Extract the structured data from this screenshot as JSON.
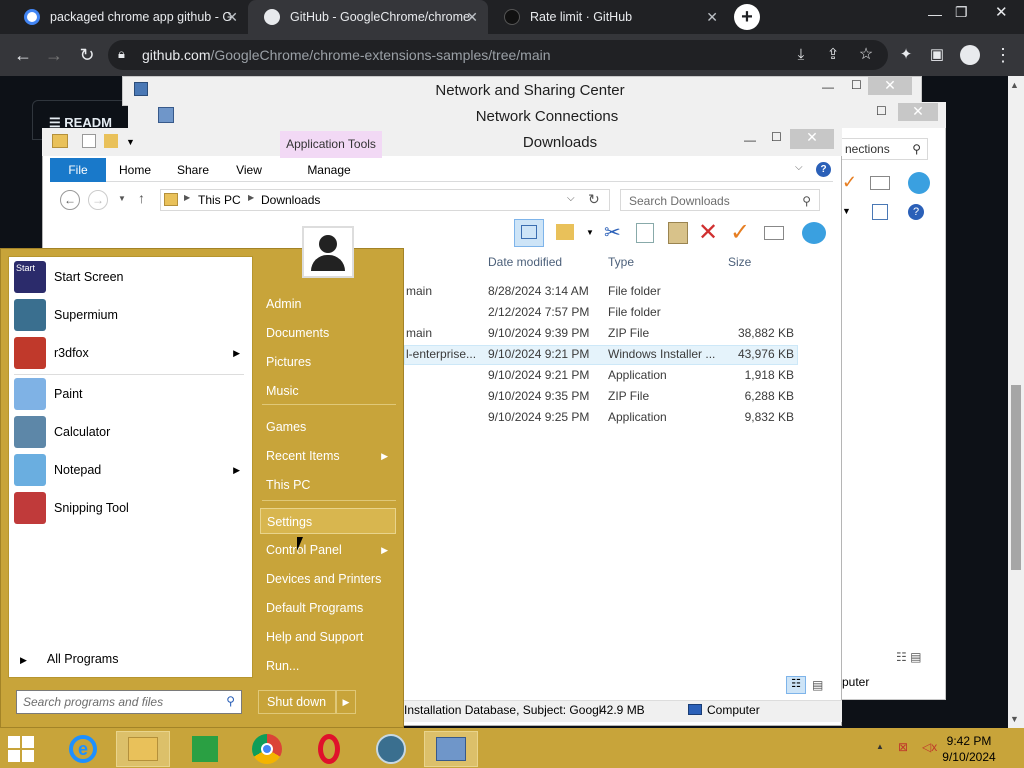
{
  "chrome": {
    "tabs": [
      {
        "title": "packaged chrome app github - G"
      },
      {
        "title": "GitHub - GoogleChrome/chrome-"
      },
      {
        "title": "Rate limit · GitHub"
      }
    ],
    "new_tab_icon": "+",
    "url_host": "github.com",
    "url_path": "/GoogleChrome/chrome-extensions-samples/tree/main"
  },
  "github": {
    "readme_label": "READM"
  },
  "windows": {
    "network_sharing_title": "Network and Sharing Center",
    "network_connections_title": "Network Connections",
    "nc_search_partial": "nections",
    "nc_status_partial": "puter"
  },
  "downloads": {
    "title": "Downloads",
    "app_tools": "Application Tools",
    "ribbon_tabs": [
      "File",
      "Home",
      "Share",
      "View",
      "Manage"
    ],
    "breadcrumb": [
      "This PC",
      "Downloads"
    ],
    "search_placeholder": "Search Downloads",
    "columns": [
      "Date modified",
      "Type",
      "Size"
    ],
    "rows": [
      {
        "name_partial": "main",
        "date": "8/28/2024 3:14 AM",
        "type": "File folder",
        "size": ""
      },
      {
        "name_partial": "",
        "date": "2/12/2024 7:57 PM",
        "type": "File folder",
        "size": ""
      },
      {
        "name_partial": "main",
        "date": "9/10/2024 9:39 PM",
        "type": "ZIP File",
        "size": "38,882 KB"
      },
      {
        "name_partial": "l-enterprise...",
        "date": "9/10/2024 9:21 PM",
        "type": "Windows Installer ...",
        "size": "43,976 KB"
      },
      {
        "name_partial": "",
        "date": "9/10/2024 9:21 PM",
        "type": "Application",
        "size": "1,918 KB"
      },
      {
        "name_partial": "",
        "date": "9/10/2024 9:35 PM",
        "type": "ZIP File",
        "size": "6,288 KB"
      },
      {
        "name_partial": "",
        "date": "9/10/2024 9:25 PM",
        "type": "Application",
        "size": "9,832 KB"
      }
    ],
    "status_text": "Installation Database, Subject: Googl",
    "status_size": "42.9 MB",
    "status_location": "Computer"
  },
  "start_menu": {
    "programs": [
      {
        "label": "Start Screen",
        "icon": "start-screen-icon",
        "color": "#2b2b6b",
        "submenu": false
      },
      {
        "label": "Supermium",
        "icon": "supermium-icon",
        "color": "#3a6f8f",
        "submenu": false
      },
      {
        "label": "r3dfox",
        "icon": "r3dfox-icon",
        "color": "#c0392b",
        "submenu": true
      },
      {
        "label": "Paint",
        "icon": "paint-icon",
        "color": "#7fb2e5",
        "submenu": false
      },
      {
        "label": "Calculator",
        "icon": "calculator-icon",
        "color": "#5d87a8",
        "submenu": false
      },
      {
        "label": "Notepad",
        "icon": "notepad-icon",
        "color": "#6aaee0",
        "submenu": true
      },
      {
        "label": "Snipping Tool",
        "icon": "scissors-icon",
        "color": "#c03a3a",
        "submenu": false
      }
    ],
    "start_icon_label": "Start",
    "all_programs": "All Programs",
    "search_placeholder": "Search programs and files",
    "right_items": [
      {
        "label": "Admin",
        "submenu": false
      },
      {
        "label": "Documents",
        "submenu": false
      },
      {
        "label": "Pictures",
        "submenu": false
      },
      {
        "label": "Music",
        "submenu": false
      },
      {
        "label": "Games",
        "submenu": false
      },
      {
        "label": "Recent Items",
        "submenu": true
      },
      {
        "label": "This PC",
        "submenu": false
      },
      {
        "label": "Settings",
        "submenu": false
      },
      {
        "label": "Control Panel",
        "submenu": true
      },
      {
        "label": "Devices and Printers",
        "submenu": false
      },
      {
        "label": "Default Programs",
        "submenu": false
      },
      {
        "label": "Help and Support",
        "submenu": false
      },
      {
        "label": "Run...",
        "submenu": false
      }
    ],
    "shutdown": "Shut down"
  },
  "taskbar": {
    "time": "9:42 PM",
    "date": "9/10/2024",
    "accent": "#c8a43a"
  }
}
